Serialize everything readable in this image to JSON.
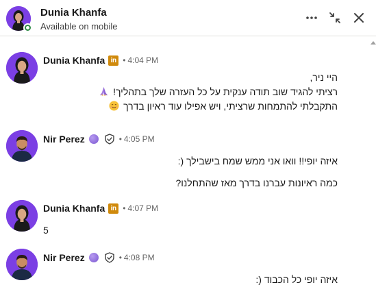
{
  "header": {
    "name": "Dunia Khanfa",
    "status": "Available on mobile",
    "more_icon": "more-horizontal-icon",
    "collapse_icon": "collapse-icon",
    "close_icon": "close-icon"
  },
  "messages": [
    {
      "sender": "Dunia Khanfa",
      "badge": "in",
      "separator": "•",
      "time": "4:04 PM",
      "lines": [
        "היי ניר,",
        "רציתי להגיד שוב תודה ענקית על כל העזרה שלך בתהליך!",
        "התקבלתי להתמחות שרציתי, ויש אפילו עוד ראיון בדרך"
      ],
      "emojis": [
        "praying-hands-emoji",
        "smiling-face-emoji"
      ]
    },
    {
      "sender": "Nir Perez",
      "separator": "•",
      "time": "4:05 PM",
      "lines": [
        "איזה יופי!! וואו אני ממש שמח בישבילך (:",
        "כמה ראיונות עברנו בדרך מאז שהתחלנו?"
      ]
    },
    {
      "sender": "Dunia Khanfa",
      "badge": "in",
      "separator": "•",
      "time": "4:07 PM",
      "lines": [
        "5"
      ]
    },
    {
      "sender": "Nir Perez",
      "separator": "•",
      "time": "4:08 PM",
      "lines": [
        "איזה יופי כל הכבוד (:"
      ]
    }
  ],
  "colors": {
    "linkedin_badge": "#d08a0c",
    "online": "#2e8a45",
    "avatar_bg": "#7b3fe4",
    "premium": "#8a63d9"
  }
}
